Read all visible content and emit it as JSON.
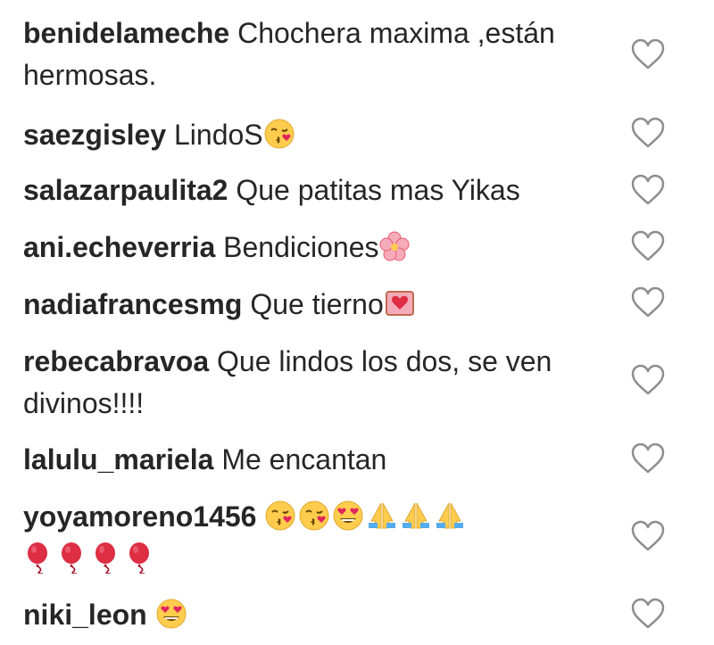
{
  "comments": [
    {
      "user": "benidelameche",
      "text": "Chochera maxima ,están hermosas."
    },
    {
      "user": "saezgisley",
      "text": "LindoS"
    },
    {
      "user": "salazarpaulita2",
      "text": "Que patitas mas Yikas"
    },
    {
      "user": "ani.echeverria",
      "text": "Bendiciones"
    },
    {
      "user": "nadiafrancesmg",
      "text": "Que tierno"
    },
    {
      "user": "rebecabravoa",
      "text": "Que lindos los dos, se ven divinos!!!!"
    },
    {
      "user": "lalulu_mariela",
      "text": "Me encantan"
    },
    {
      "user": "yoyamoreno1456",
      "text": ""
    },
    {
      "user": "niki_leon",
      "text": ""
    }
  ],
  "emoji_names": {
    "c1": "kissing-face-icon",
    "c3": "cherry-blossom-icon",
    "c4": "heart-box-icon",
    "c7": [
      "kissing-face-icon",
      "kissing-face-icon",
      "heart-eyes-face-icon",
      "folded-hands-icon",
      "folded-hands-icon",
      "folded-hands-icon",
      "balloon-icon",
      "balloon-icon",
      "balloon-icon",
      "balloon-icon"
    ],
    "c8": "heart-eyes-face-icon"
  },
  "colors": {
    "text": "#262626",
    "heart_outline": "#8e8e8e"
  }
}
